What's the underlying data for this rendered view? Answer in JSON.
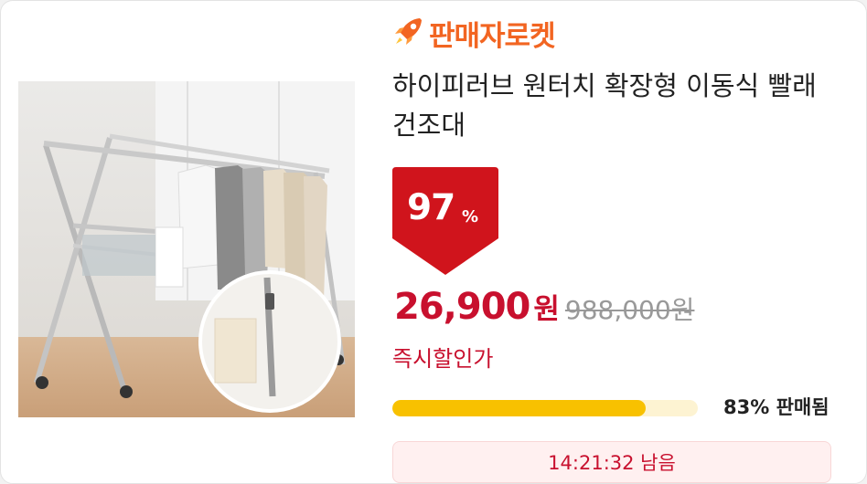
{
  "brand": {
    "name": "판매자로켓",
    "icon": "rocket-icon",
    "color": "#f26522"
  },
  "product": {
    "title": "하이피러브 원터치 확장형 이동식 빨래건조대",
    "image_alt": "product-photo-drying-rack"
  },
  "discount": {
    "percent": "97",
    "percent_sign": "%",
    "badge_color": "#d0141c"
  },
  "price": {
    "sale": "26,900",
    "sale_unit": "원",
    "original": "988,000원",
    "label": "즉시할인가",
    "color": "#c8102e"
  },
  "sales": {
    "sold_fraction": 0.83,
    "sold_text": "83% 판매됨",
    "bar_color": "#f8c100"
  },
  "timer": {
    "text": "14:21:32 남음"
  }
}
